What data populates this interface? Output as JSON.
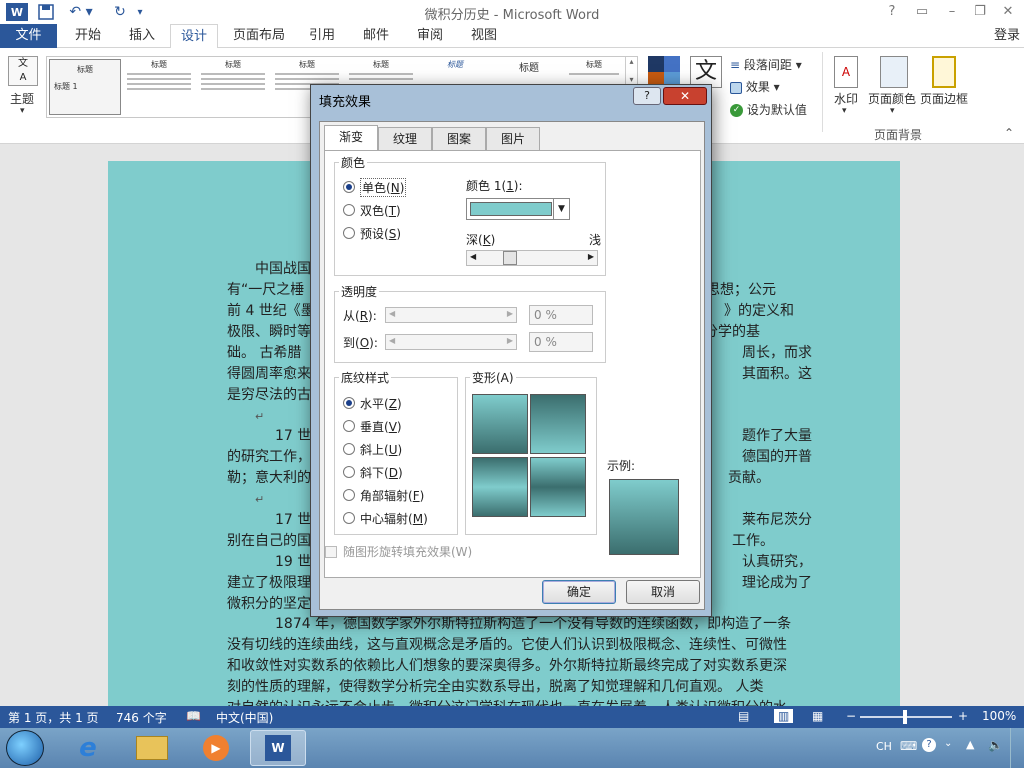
{
  "window": {
    "title": "微积分历史 - Microsoft Word",
    "account": "登录"
  },
  "quick_access": {
    "save_icon": "save-icon",
    "undo_icon": "undo-icon",
    "redo_icon": "redo-icon"
  },
  "ribbon_tabs": [
    {
      "label": "文件"
    },
    {
      "label": "开始"
    },
    {
      "label": "插入"
    },
    {
      "label": "设计"
    },
    {
      "label": "页面布局"
    },
    {
      "label": "引用"
    },
    {
      "label": "邮件"
    },
    {
      "label": "审阅"
    },
    {
      "label": "视图"
    }
  ],
  "ribbon": {
    "theme_label": "主题",
    "gallery_titles": [
      "标题",
      "标题",
      "标题",
      "标题",
      "标题",
      "标题",
      "标题",
      "标题"
    ],
    "gallery_first_sub": "标题 1",
    "paragraph_spacing": "段落间距",
    "effects": "效果",
    "set_default": "设为默认值",
    "watermark": "水印",
    "page_color": "页面颜色",
    "page_border": "页面边框",
    "group_page_background": "页面背景",
    "text_icon": "文"
  },
  "document": {
    "lines": [
      "中国战国",
      "篇”中，记",
      "有“一尺之棰",
      "思想；公元",
      "前 4 世纪《墨",
      "》的定义和",
      "极限、瞬时等",
      "积分学的基",
      "础。    古希腊",
      "周长，而求",
      "得圆周率愈来",
      "其面积。这",
      "是穷尽法的古",
      "17 世纪",
      "题作了大量",
      "的研究工作，",
      "德国的开普",
      "勒；意大利的",
      "贡献。",
      "17 世纪",
      "莱布尼茨分",
      "别在自己的国",
      "工作。",
      "19 世纪",
      "认真研究，",
      "建立了极限理",
      "理论成为了",
      "微积分的坚定",
      "1874 年，德国数学家外尔斯特拉斯构造了一个没有导数的连续函数，即构造了一条",
      "没有切线的连续曲线，这与直观概念是矛盾的。它使人们认识到极限概念、连续性、可微性",
      "和收敛性对实数系的依赖比人们想象的要深奥得多。外尔斯特拉斯最终完成了对实数系更深",
      "刻的性质的理解，使得数学分析完全由实数系导出，脱离了知觉理解和几何直观。    人类",
      "对自然的认识永远不会止步，微积分这门学科在现代也一直在发展着。人类认识微积分的水"
    ]
  },
  "dialog": {
    "title": "填充效果",
    "tabs": [
      "渐变",
      "纹理",
      "图案",
      "图片"
    ],
    "colors_group": "颜色",
    "color_options": [
      {
        "label": "单色",
        "key": "N",
        "selected": true
      },
      {
        "label": "双色",
        "key": "T",
        "selected": false
      },
      {
        "label": "预设",
        "key": "S",
        "selected": false
      }
    ],
    "color1_label": "颜色 1(",
    "color1_key": "1",
    "color1_suffix": "):",
    "color1_value": "#7fcccc",
    "dark_label": "深(",
    "dark_key": "K",
    "light_label": "浅",
    "transparency_group": "透明度",
    "from_label": "从(",
    "from_key": "R",
    "from_value": "0 %",
    "to_label": "到(",
    "to_key": "O",
    "to_value": "0 %",
    "shading_group": "底纹样式",
    "shading_options": [
      {
        "label": "水平",
        "key": "Z",
        "selected": true
      },
      {
        "label": "垂直",
        "key": "V",
        "selected": false
      },
      {
        "label": "斜上",
        "key": "U",
        "selected": false
      },
      {
        "label": "斜下",
        "key": "D",
        "selected": false
      },
      {
        "label": "角部辐射",
        "key": "F",
        "selected": false
      },
      {
        "label": "中心辐射",
        "key": "M",
        "selected": false
      }
    ],
    "variants_label": "变形(A)",
    "sample_label": "示例:",
    "rotate_label": "随图形旋转填充效果(W)",
    "ok": "确定",
    "cancel": "取消"
  },
  "status": {
    "page": "第 1 页，共 1 页",
    "words": "746 个字",
    "language": "中文(中国)",
    "zoom": "100%"
  },
  "taskbar": {
    "ime": "CH"
  },
  "colors": {
    "accent": "#2b579a",
    "page_fill": "#7fcccc",
    "gradient_dark": "#3b6e6e"
  }
}
